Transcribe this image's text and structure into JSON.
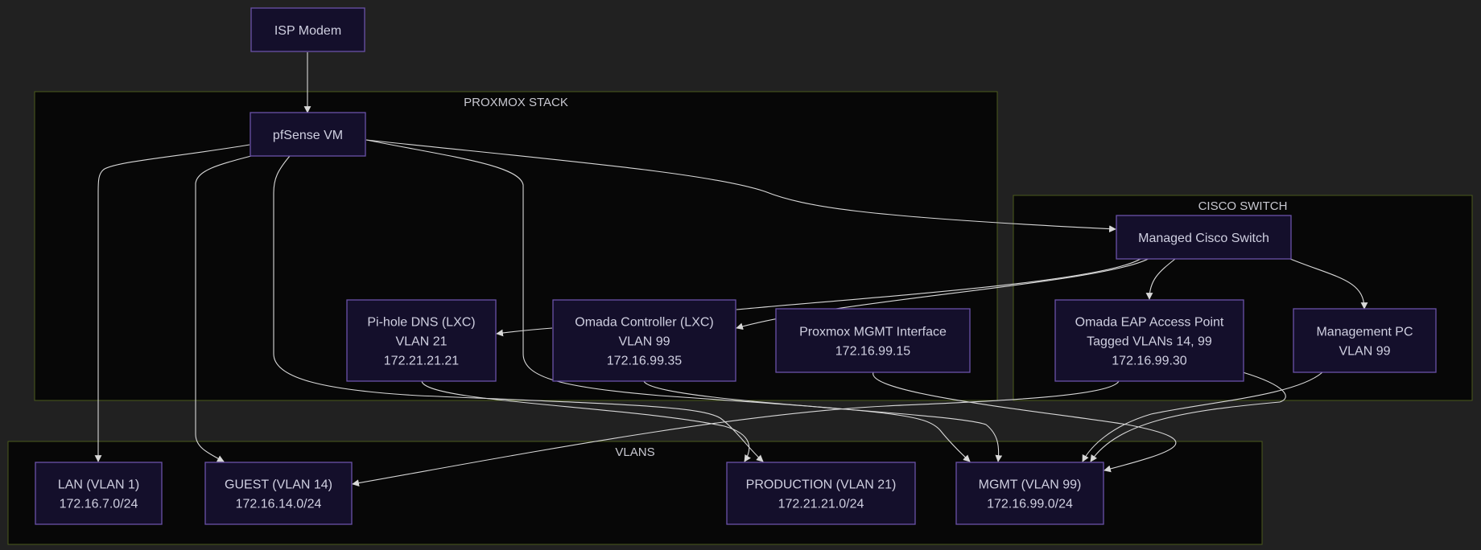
{
  "colors": {
    "background": "#212121",
    "cluster_fill": "#070707",
    "cluster_border": "#4b5a1c",
    "node_fill": "#140f2b",
    "node_border": "#6a52a8",
    "node_text": "#cfcfe0",
    "edge": "#d8d8d8"
  },
  "clusters": {
    "proxmox": {
      "label": "PROXMOX STACK"
    },
    "cisco": {
      "label": "CISCO SWITCH"
    },
    "vlans": {
      "label": "VLANS"
    }
  },
  "nodes": {
    "isp_modem": {
      "lines": [
        "ISP Modem"
      ]
    },
    "pfsense": {
      "lines": [
        "pfSense VM"
      ]
    },
    "pihole": {
      "lines": [
        "Pi-hole DNS (LXC)",
        "VLAN 21",
        "172.21.21.21"
      ]
    },
    "omada_ctrl": {
      "lines": [
        "Omada Controller (LXC)",
        "VLAN 99",
        "172.16.99.35"
      ]
    },
    "proxmox_mgmt": {
      "lines": [
        "Proxmox MGMT Interface",
        "172.16.99.15"
      ]
    },
    "cisco_switch": {
      "lines": [
        "Managed Cisco Switch"
      ]
    },
    "omada_eap": {
      "lines": [
        "Omada EAP Access Point",
        "Tagged VLANs 14, 99",
        "172.16.99.30"
      ]
    },
    "mgmt_pc": {
      "lines": [
        "Management PC",
        "VLAN 99"
      ]
    },
    "lan": {
      "lines": [
        "LAN (VLAN 1)",
        "172.16.7.0/24"
      ]
    },
    "guest": {
      "lines": [
        "GUEST (VLAN 14)",
        "172.16.14.0/24"
      ]
    },
    "production": {
      "lines": [
        "PRODUCTION (VLAN 21)",
        "172.21.21.0/24"
      ]
    },
    "mgmt_vlan": {
      "lines": [
        "MGMT (VLAN 99)",
        "172.16.99.0/24"
      ]
    }
  }
}
